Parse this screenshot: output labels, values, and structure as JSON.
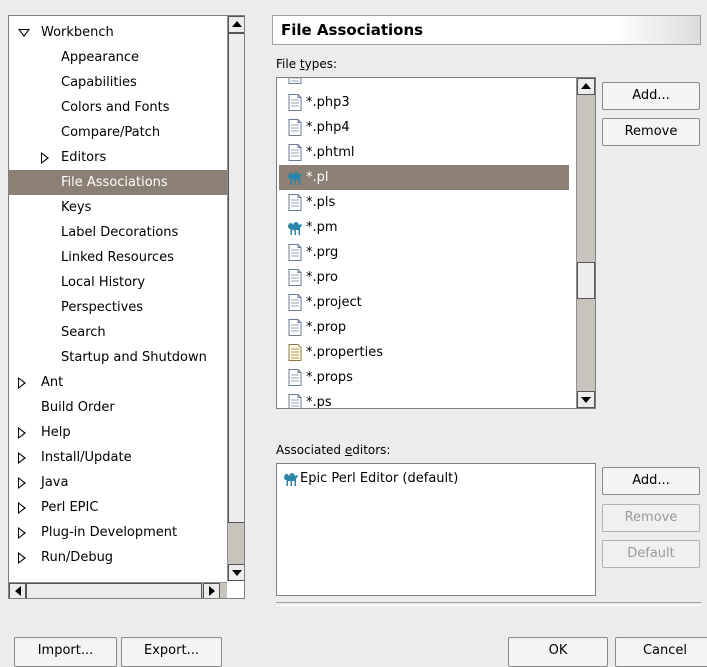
{
  "tree": {
    "items": [
      {
        "label": "Workbench",
        "level": 0,
        "expander": "expanded"
      },
      {
        "label": "Appearance",
        "level": 1,
        "expander": "none"
      },
      {
        "label": "Capabilities",
        "level": 1,
        "expander": "none"
      },
      {
        "label": "Colors and Fonts",
        "level": 1,
        "expander": "none"
      },
      {
        "label": "Compare/Patch",
        "level": 1,
        "expander": "none"
      },
      {
        "label": "Editors",
        "level": 1,
        "expander": "collapsed"
      },
      {
        "label": "File Associations",
        "level": 1,
        "expander": "none",
        "selected": true
      },
      {
        "label": "Keys",
        "level": 1,
        "expander": "none"
      },
      {
        "label": "Label Decorations",
        "level": 1,
        "expander": "none"
      },
      {
        "label": "Linked Resources",
        "level": 1,
        "expander": "none"
      },
      {
        "label": "Local History",
        "level": 1,
        "expander": "none"
      },
      {
        "label": "Perspectives",
        "level": 1,
        "expander": "none"
      },
      {
        "label": "Search",
        "level": 1,
        "expander": "none"
      },
      {
        "label": "Startup and Shutdown",
        "level": 1,
        "expander": "none"
      },
      {
        "label": "Ant",
        "level": 0,
        "expander": "collapsed"
      },
      {
        "label": "Build Order",
        "level": 0,
        "expander": "none"
      },
      {
        "label": "Help",
        "level": 0,
        "expander": "collapsed"
      },
      {
        "label": "Install/Update",
        "level": 0,
        "expander": "collapsed"
      },
      {
        "label": "Java",
        "level": 0,
        "expander": "collapsed"
      },
      {
        "label": "Perl EPIC",
        "level": 0,
        "expander": "collapsed"
      },
      {
        "label": "Plug-in Development",
        "level": 0,
        "expander": "collapsed"
      },
      {
        "label": "Run/Debug",
        "level": 0,
        "expander": "collapsed"
      }
    ]
  },
  "page": {
    "title": "File Associations",
    "file_types_label_prefix": "File ",
    "file_types_label_mnemonic": "t",
    "file_types_label_suffix": "ypes:",
    "file_types": [
      {
        "label": "*.php3",
        "icon": "text-file-icon"
      },
      {
        "label": "*.php4",
        "icon": "text-file-icon"
      },
      {
        "label": "*.phtml",
        "icon": "text-file-icon"
      },
      {
        "label": "*.pl",
        "icon": "camel-icon",
        "selected": true
      },
      {
        "label": "*.pls",
        "icon": "text-file-icon"
      },
      {
        "label": "*.pm",
        "icon": "camel-icon"
      },
      {
        "label": "*.prg",
        "icon": "text-file-icon"
      },
      {
        "label": "*.pro",
        "icon": "text-file-icon"
      },
      {
        "label": "*.project",
        "icon": "text-file-icon"
      },
      {
        "label": "*.prop",
        "icon": "text-file-icon"
      },
      {
        "label": "*.properties",
        "icon": "properties-file-icon"
      },
      {
        "label": "*.props",
        "icon": "text-file-icon"
      },
      {
        "label": "*.ps",
        "icon": "text-file-icon"
      }
    ],
    "add_label": "Add...",
    "remove_label": "Remove",
    "editors_label_prefix": "Associated ",
    "editors_label_mnemonic": "e",
    "editors_label_suffix": "ditors:",
    "editors": [
      {
        "label": "Epic Perl Editor (default)",
        "icon": "camel-icon"
      }
    ],
    "editor_add_label": "Add...",
    "editor_remove_label": "Remove",
    "editor_default_label": "Default"
  },
  "footer": {
    "import_label": "Import...",
    "export_label": "Export...",
    "ok_label": "OK",
    "cancel_label": "Cancel"
  },
  "colors": {
    "selection": "#8c7f73",
    "camel": "#2a86a8"
  }
}
